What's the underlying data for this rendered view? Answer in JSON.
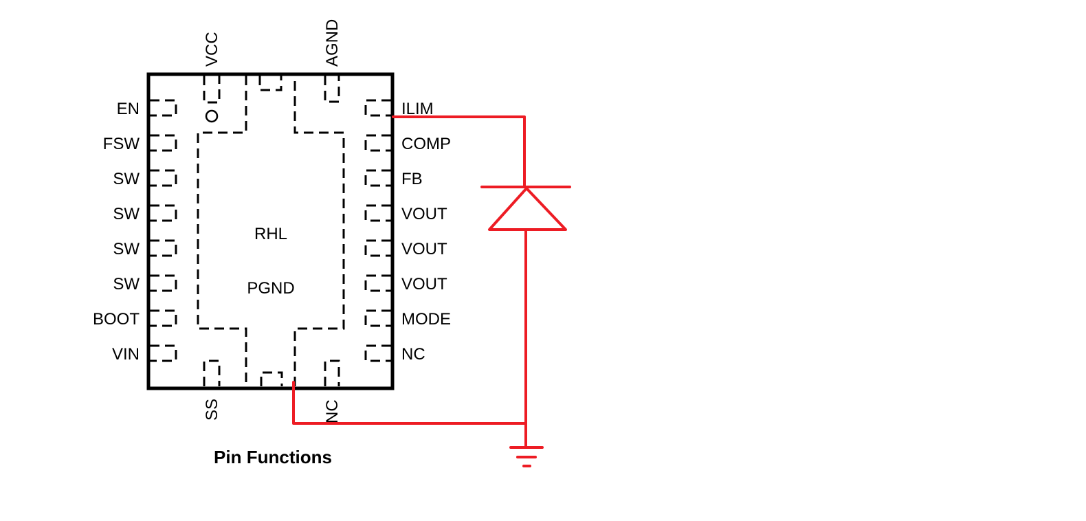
{
  "diagram": {
    "caption": "Pin Functions",
    "package_marker": "RHL",
    "thermal_pad_label": "PGND",
    "left_pins": [
      "EN",
      "FSW",
      "SW",
      "SW",
      "SW",
      "SW",
      "BOOT",
      "VIN"
    ],
    "right_pins": [
      "ILIM",
      "COMP",
      "FB",
      "VOUT",
      "VOUT",
      "VOUT",
      "MODE",
      "NC"
    ],
    "top_pins": [
      "VCC",
      "AGND"
    ],
    "bottom_pins": [
      "SS",
      "NC"
    ],
    "annotation": {
      "description": "Hand-drawn red diode from ILIM to PGND (ground)",
      "color": "#ED1C24",
      "components": [
        "diode",
        "ground-symbol"
      ]
    }
  }
}
